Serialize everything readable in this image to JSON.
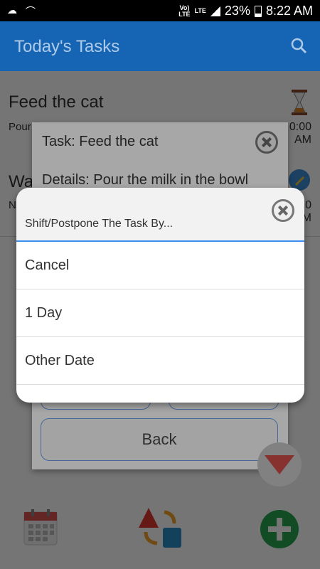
{
  "status": {
    "volte": "Vo) LTE",
    "lte": "LTE",
    "roaming": "R",
    "battery": "23%",
    "time": "8:22 AM"
  },
  "appbar": {
    "title": "Today's Tasks",
    "search_icon": "search-icon"
  },
  "tasks": [
    {
      "title": "Feed the cat",
      "subtitle": "Pour",
      "time": "0:00",
      "ampm": "AM",
      "icon": "hourglass-icon"
    },
    {
      "title": "Wa",
      "subtitle": "N",
      "time": "0",
      "ampm": "M",
      "icon": "pencil-icon"
    }
  ],
  "task_dialog": {
    "title": "Task: Feed the cat",
    "details": "Details: Pour the milk in the bowl",
    "back_label": "Back"
  },
  "shift_dialog": {
    "title": "Shift/Postpone The Task By...",
    "options": [
      "Cancel",
      "1 Day",
      "Other Date"
    ]
  },
  "bottom_bar": [
    "calendar-icon",
    "shapes-sync-icon",
    "add-icon"
  ],
  "colors": {
    "appbar": "#1665b5",
    "accent": "#3d8ef2",
    "add": "#27a550"
  }
}
